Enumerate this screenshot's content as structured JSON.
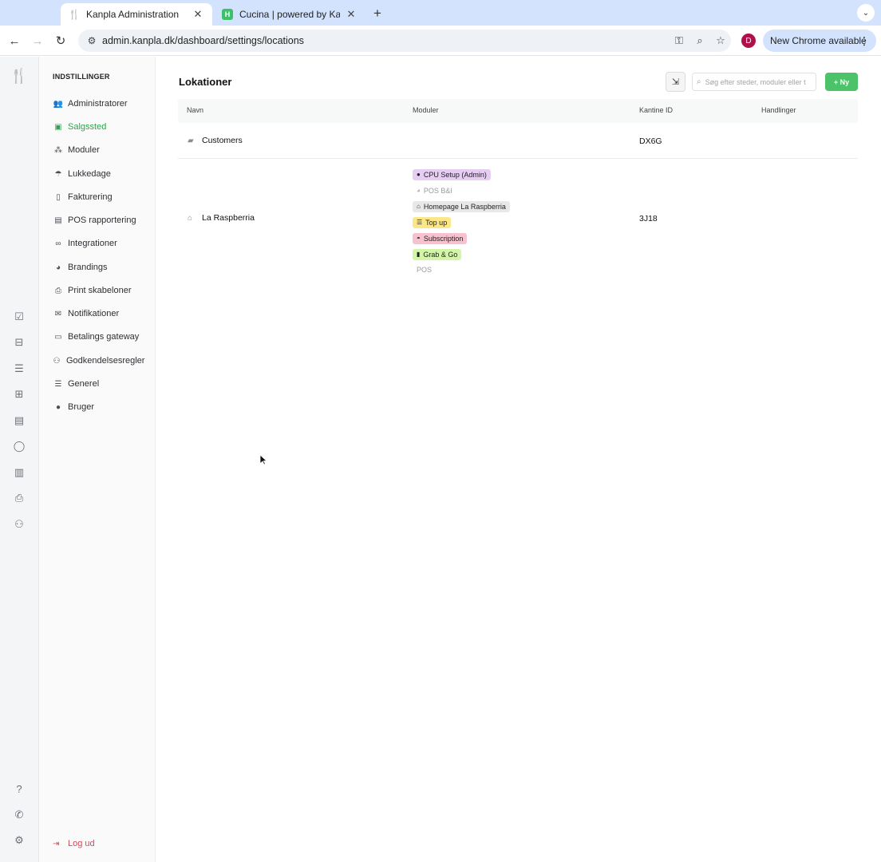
{
  "browser": {
    "tabs": [
      {
        "title": "Kanpla Administration",
        "favicon_color": "#2b2b2b",
        "active": true
      },
      {
        "title": "Cucina | powered by Kanpla",
        "favicon_color": "#3cc06a",
        "favicon_letter": "H",
        "active": false
      }
    ],
    "url": "admin.kanpla.dk/dashboard/settings/locations",
    "profile_initial": "D",
    "update_label": "New Chrome available"
  },
  "sidebar": {
    "heading": "INDSTILLINGER",
    "items": [
      {
        "label": "Administratorer",
        "icon": "admin-users-icon",
        "active": false
      },
      {
        "label": "Salgssted",
        "icon": "store-icon",
        "active": true
      },
      {
        "label": "Moduler",
        "icon": "modules-icon",
        "active": false
      },
      {
        "label": "Lukkedage",
        "icon": "beach-umbrella-icon",
        "active": false
      },
      {
        "label": "Fakturering",
        "icon": "invoice-icon",
        "active": false
      },
      {
        "label": "POS rapportering",
        "icon": "report-icon",
        "active": false
      },
      {
        "label": "Integrationer",
        "icon": "link-icon",
        "active": false
      },
      {
        "label": "Brandings",
        "icon": "palette-icon",
        "active": false
      },
      {
        "label": "Print skabeloner",
        "icon": "printer-icon",
        "active": false
      },
      {
        "label": "Notifikationer",
        "icon": "envelope-icon",
        "active": false
      },
      {
        "label": "Betalings gateway",
        "icon": "credit-card-icon",
        "active": false
      },
      {
        "label": "Godkendelsesregler",
        "icon": "user-check-icon",
        "active": false
      },
      {
        "label": "Generel",
        "icon": "sliders-icon",
        "active": false
      },
      {
        "label": "Bruger",
        "icon": "user-icon",
        "active": false
      }
    ],
    "logout": "Log ud"
  },
  "page": {
    "title": "Lokationer",
    "search_placeholder": "Søg efter steder, moduler eller t",
    "new_label": "+ Ny"
  },
  "table": {
    "columns": [
      "Navn",
      "Moduler",
      "Kantine ID",
      "Handlinger"
    ],
    "rows": [
      {
        "name": "Customers",
        "icon": "folder-icon",
        "kantine_id": "DX6G",
        "modules": []
      },
      {
        "name": "La Raspberria",
        "icon": "shop-icon",
        "kantine_id": "3J18",
        "modules": [
          {
            "label": "CPU Setup (Admin)",
            "icon": "apple-icon",
            "color": "#e6cdf3",
            "faded": false
          },
          {
            "label": "POS B&I",
            "icon": "palette-icon",
            "color": "",
            "faded": true
          },
          {
            "label": "Homepage La Raspberria",
            "icon": "home-icon",
            "color": "#e8e8e8",
            "faded": false
          },
          {
            "label": "Top up",
            "icon": "list-icon",
            "color": "#fbe78a",
            "faded": false
          },
          {
            "label": "Subscription",
            "icon": "bowl-icon",
            "color": "#f6c2cf",
            "faded": false
          },
          {
            "label": "Grab & Go",
            "icon": "cup-icon",
            "color": "#d3f5a8",
            "faded": false
          },
          {
            "label": "POS",
            "icon": "",
            "color": "",
            "faded": true
          }
        ]
      }
    ]
  },
  "colors": {
    "accent": "#2da44e",
    "new_button": "#4cc368",
    "logout": "#d6455a"
  }
}
